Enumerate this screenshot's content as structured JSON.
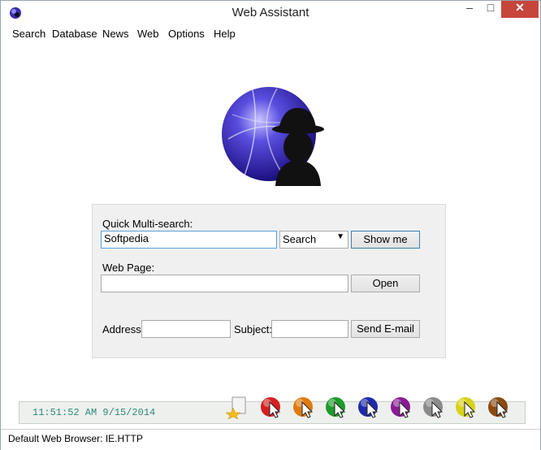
{
  "window": {
    "title": "Web Assistant",
    "controls": {
      "minimize": "–",
      "maximize": "□",
      "close": "✕"
    }
  },
  "menu": [
    "Search",
    "Database",
    "News",
    "Web",
    "Options",
    "Help"
  ],
  "quick_search": {
    "label": "Quick Multi-search:",
    "value": "Softpedia",
    "engine": "Search",
    "button": "Show me"
  },
  "web_page": {
    "label": "Web Page:",
    "value": "",
    "button": "Open"
  },
  "email": {
    "address_label": "Address:",
    "address_value": "",
    "subject_label": "Subject:",
    "subject_value": "",
    "button": "Send E-mail"
  },
  "clock": "11:51:52 AM 9/15/2014",
  "toolbar_icons": [
    {
      "name": "notes-star-icon"
    },
    {
      "name": "red-cursor-icon",
      "color": "#d42020"
    },
    {
      "name": "orange-cursor-icon",
      "color": "#e07a10"
    },
    {
      "name": "green-cursor-icon",
      "color": "#1e9a2a"
    },
    {
      "name": "blue-cursor-icon",
      "color": "#1f2aa8"
    },
    {
      "name": "purple-cursor-icon",
      "color": "#8a1c94"
    },
    {
      "name": "gray-cursor-icon",
      "color": "#8a8a8a"
    },
    {
      "name": "yellow-cursor-icon",
      "color": "#d8d21a"
    },
    {
      "name": "brown-cursor-icon",
      "color": "#8a4a12"
    }
  ],
  "status": "Default Web Browser: IE.HTTP"
}
